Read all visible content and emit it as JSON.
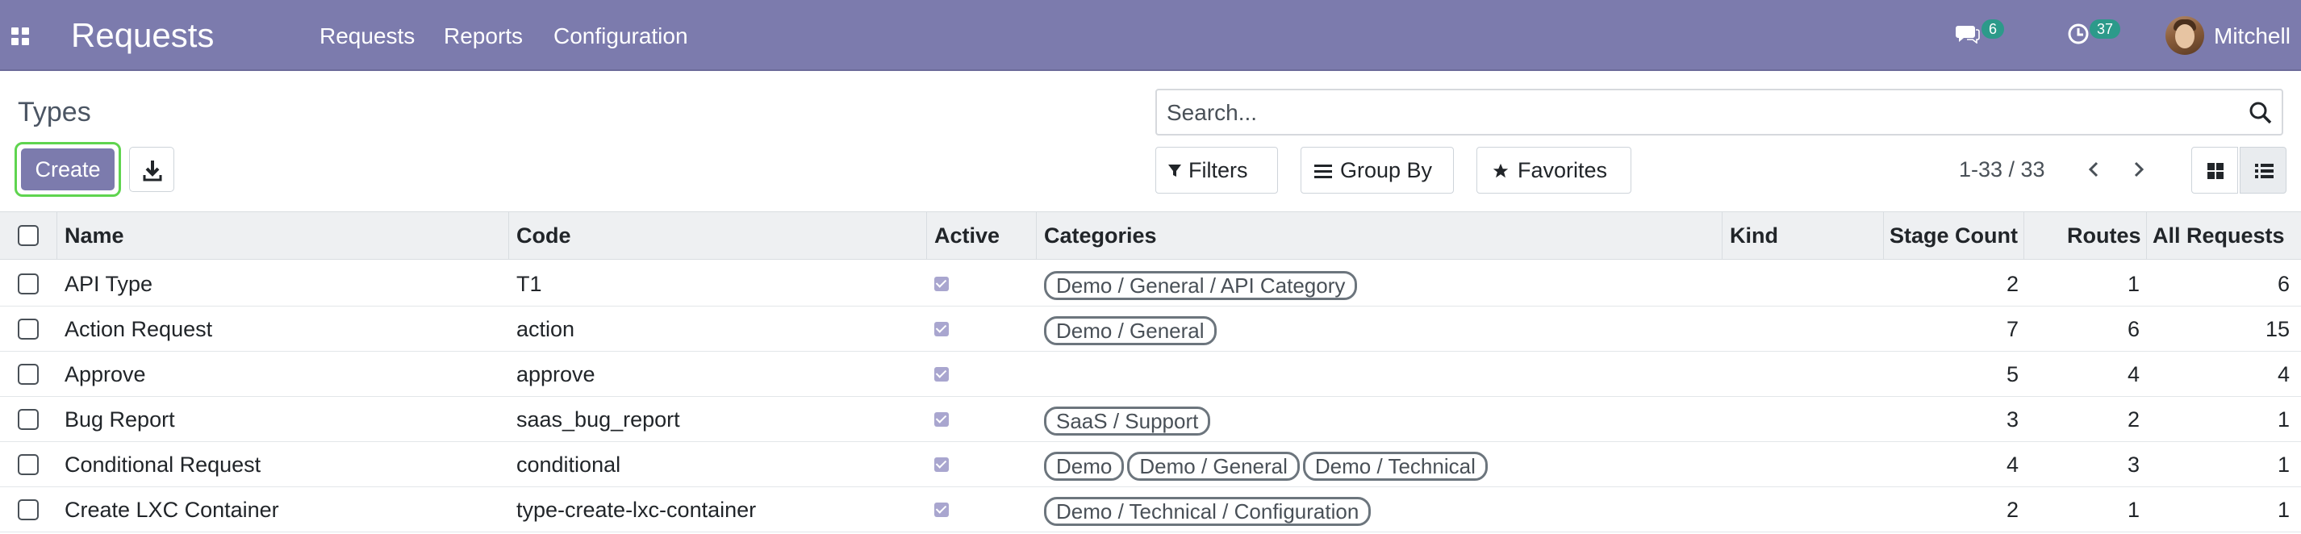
{
  "app": {
    "title": "Requests",
    "menu": [
      "Requests",
      "Reports",
      "Configuration"
    ],
    "messages_count": "6",
    "activities_count": "37",
    "user_name": "Mitchell"
  },
  "control_panel": {
    "page_title": "Types",
    "create_label": "Create",
    "search_placeholder": "Search...",
    "filters_label": "Filters",
    "group_by_label": "Group By",
    "favorites_label": "Favorites",
    "pager": "1-33 / 33"
  },
  "table": {
    "columns": [
      "Name",
      "Code",
      "Active",
      "Categories",
      "Kind",
      "Stage Count",
      "Routes",
      "All Requests"
    ],
    "rows": [
      {
        "name": "API Type",
        "code": "T1",
        "active": true,
        "categories": [
          "Demo / General / API Category"
        ],
        "kind": "",
        "stage_count": "2",
        "routes": "1",
        "all_requests": "6"
      },
      {
        "name": "Action Request",
        "code": "action",
        "active": true,
        "categories": [
          "Demo / General"
        ],
        "kind": "",
        "stage_count": "7",
        "routes": "6",
        "all_requests": "15"
      },
      {
        "name": "Approve",
        "code": "approve",
        "active": true,
        "categories": [],
        "kind": "",
        "stage_count": "5",
        "routes": "4",
        "all_requests": "4"
      },
      {
        "name": "Bug Report",
        "code": "saas_bug_report",
        "active": true,
        "categories": [
          "SaaS / Support"
        ],
        "kind": "",
        "stage_count": "3",
        "routes": "2",
        "all_requests": "1"
      },
      {
        "name": "Conditional Request",
        "code": "conditional",
        "active": true,
        "categories": [
          "Demo",
          "Demo / General",
          "Demo / Technical"
        ],
        "kind": "",
        "stage_count": "4",
        "routes": "3",
        "all_requests": "1"
      },
      {
        "name": "Create LXC Container",
        "code": "type-create-lxc-container",
        "active": true,
        "categories": [
          "Demo / Technical / Configuration"
        ],
        "kind": "",
        "stage_count": "2",
        "routes": "1",
        "all_requests": "1"
      }
    ]
  },
  "colors": {
    "navbar": "#7c7bad",
    "badge": "#2c9a8a",
    "create_focus": "#5fd44f"
  }
}
